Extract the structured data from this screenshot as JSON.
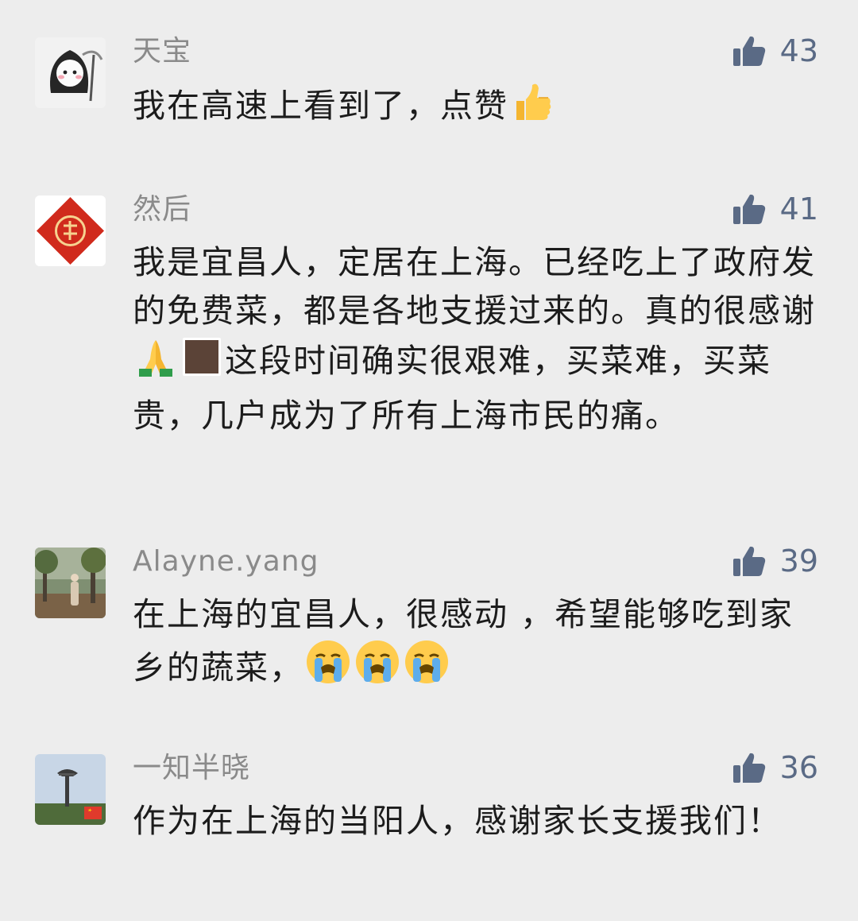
{
  "comments": [
    {
      "username": "天宝",
      "likes": "43",
      "segments": [
        {
          "type": "text",
          "value": "我在高速上看到了，点赞"
        },
        {
          "type": "emoji",
          "icon": "thumbs-up-emoji"
        }
      ]
    },
    {
      "username": "然后",
      "likes": "41",
      "segments": [
        {
          "type": "text",
          "value": "我是宜昌人，定居在上海。已经吃上了政府发的免费菜，都是各地支援过来的。真的很感谢"
        },
        {
          "type": "emoji",
          "icon": "folded-hands-emoji"
        },
        {
          "type": "emoji",
          "icon": "brown-square-emoji"
        },
        {
          "type": "text",
          "value": "这段时间确实很艰难，买菜难，买菜贵，几户成为了所有上海市民的痛。"
        }
      ]
    },
    {
      "username": "Alayne.yang",
      "likes": "39",
      "segments": [
        {
          "type": "text",
          "value": "在上海的宜昌人，很感动 ，希望能够吃到家乡的蔬菜，"
        },
        {
          "type": "emoji",
          "icon": "loudly-crying-face-emoji"
        },
        {
          "type": "emoji",
          "icon": "loudly-crying-face-emoji"
        },
        {
          "type": "emoji",
          "icon": "loudly-crying-face-emoji"
        }
      ]
    },
    {
      "username": "一知半晓",
      "likes": "36",
      "segments": [
        {
          "type": "text",
          "value": "作为在上海的当阳人，感谢家长支援我们！"
        }
      ]
    }
  ],
  "colors": {
    "background": "#ededed",
    "username": "#8a8a8a",
    "like_accent": "#5a6a85",
    "text": "#1c1c1c"
  }
}
